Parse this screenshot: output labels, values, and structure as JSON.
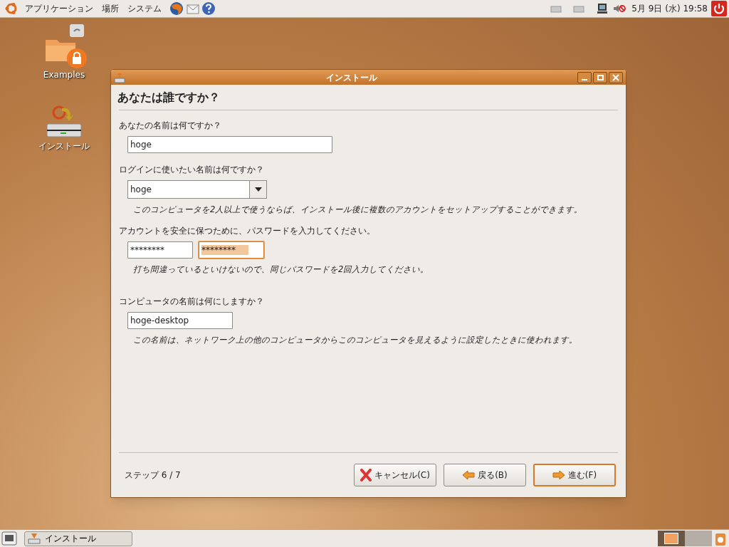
{
  "top_panel": {
    "menus": [
      {
        "label": "アプリケーション"
      },
      {
        "label": "場所"
      },
      {
        "label": "システム"
      }
    ],
    "clock": "5月 9日 (水) 19:58"
  },
  "desktop_icons": [
    {
      "label": "Examples",
      "kind": "folder"
    },
    {
      "label": "インストール",
      "kind": "installer"
    }
  ],
  "window": {
    "title": "インストール",
    "heading": "あなたは誰ですか？",
    "name": {
      "question": "あなたの名前は何ですか？",
      "value": "hoge"
    },
    "login": {
      "question": "ログインに使いたい名前は何ですか？",
      "value": "hoge",
      "note": "このコンピュータを2人以上で使うならば、インストール後に複数のアカウントをセットアップすることができます。"
    },
    "password": {
      "question": "アカウントを安全に保つために、パスワードを入力してください。",
      "fields": [
        {
          "value": "********",
          "focused": false
        },
        {
          "value": "********",
          "focused": true
        }
      ],
      "note": "打ち間違っているといけないので、同じパスワードを2回入力してください。"
    },
    "computer": {
      "question": "コンピュータの名前は何にしますか？",
      "value": "hoge-desktop",
      "note": "この名前は、ネットワーク上の他のコンピュータからこのコンピュータを見えるように設定したときに使われます。"
    },
    "step": "ステップ 6 / 7",
    "buttons": [
      {
        "label": "キャンセル(C)",
        "kind": "cancel",
        "default": false
      },
      {
        "label": "戻る(B)",
        "kind": "back",
        "default": false
      },
      {
        "label": "進む(F)",
        "kind": "forward",
        "default": true
      }
    ]
  },
  "bottom_panel": {
    "tasks": [
      {
        "label": "インストール"
      }
    ],
    "workspaces": [
      {
        "selected": true
      },
      {
        "selected": false
      }
    ]
  }
}
